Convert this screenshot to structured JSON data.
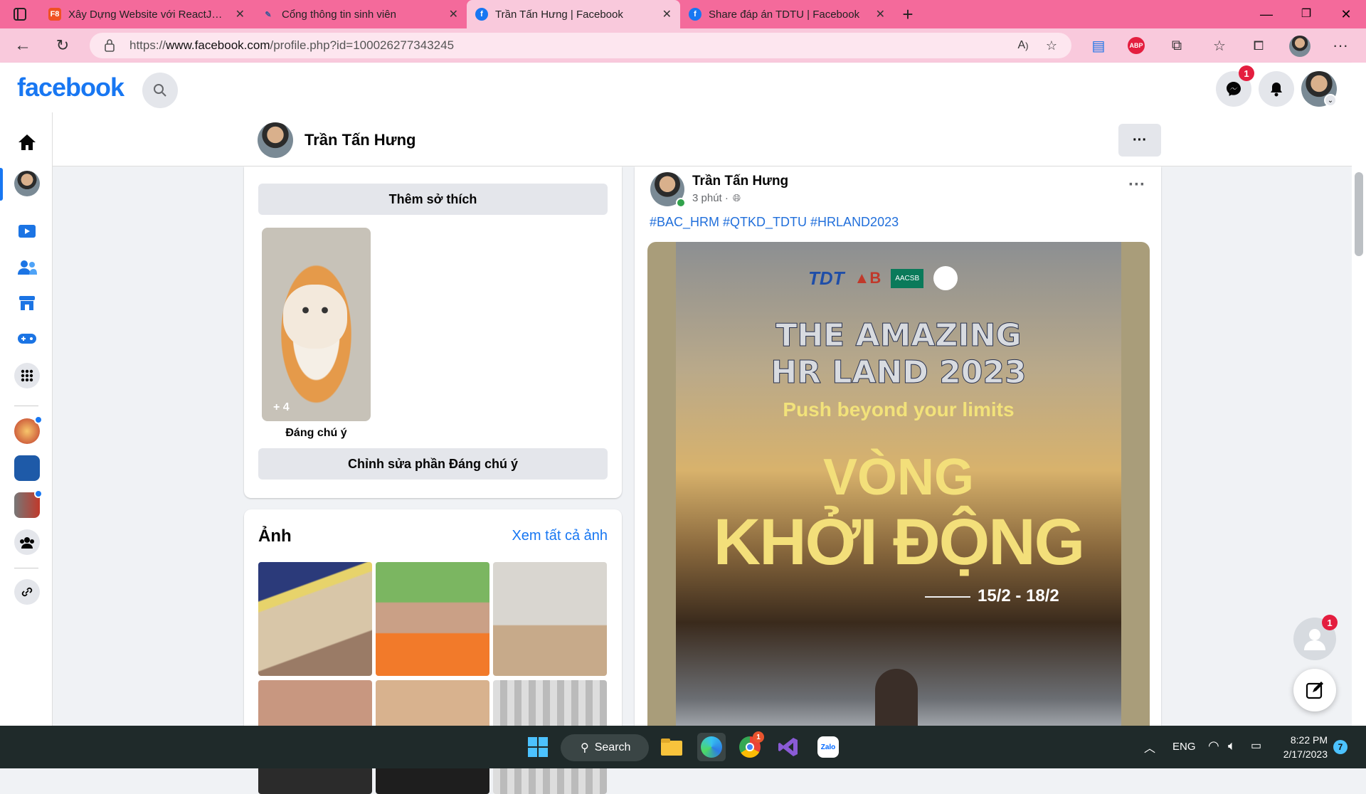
{
  "tabs": [
    {
      "title": "Xây Dựng Website với ReactJS | F8",
      "favicon": "F8",
      "color": "#f05123"
    },
    {
      "title": "Cổng thông tin sinh viên",
      "favicon": "",
      "color": "#3b5998"
    },
    {
      "title": "Trần Tấn Hưng | Facebook",
      "favicon": "f",
      "color": "#1877f2"
    },
    {
      "title": "Share đáp án TDTU | Facebook",
      "favicon": "f",
      "color": "#1877f2"
    }
  ],
  "address": {
    "prefix": "https://",
    "domain": "www.facebook.com",
    "path": "/profile.php?id=100026277343245"
  },
  "fb": {
    "logo": "facebook",
    "messenger_badge": "1",
    "profile_name": "Trần Tấn Hưng",
    "more_label": "···"
  },
  "featured": {
    "add_hobbies": "Thêm sở thích",
    "plus_count": "+ 4",
    "caption": "Đáng chú ý",
    "edit": "Chỉnh sửa phần Đáng chú ý"
  },
  "photos": {
    "title": "Ảnh",
    "see_all": "Xem tất cả ảnh"
  },
  "post": {
    "author": "Trần Tấn Hưng",
    "time": "3 phút ·",
    "hashtags": "#BAC_HRM #QTKD_TDTU #HRLAND2023",
    "poster": {
      "line1": "THE AMAZING",
      "line2": "HR LAND 2023",
      "tagline": "Push beyond your limits",
      "round1": "VÒNG",
      "round2": "KHỞI ĐỘNG",
      "dates": "15/2 - 18/2",
      "logo_text": "AACSB"
    }
  },
  "chat": {
    "badge": "1"
  },
  "taskbar": {
    "search": "Search",
    "lang": "ENG",
    "time": "8:22 PM",
    "date": "2/17/2023",
    "notif": "7",
    "chrome_badge": "1"
  }
}
